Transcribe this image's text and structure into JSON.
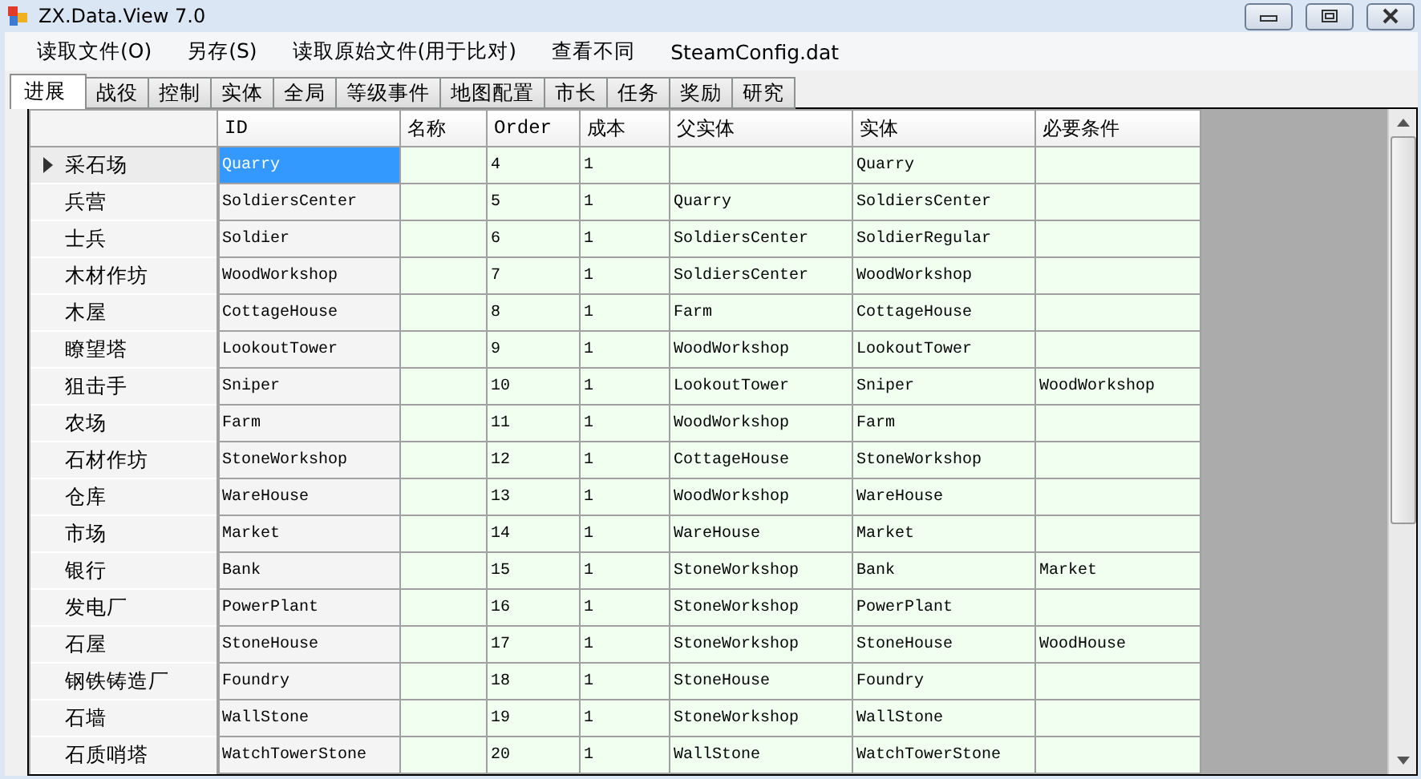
{
  "window": {
    "title": "ZX.Data.View 7.0"
  },
  "menu": [
    "读取文件(O)",
    "另存(S)",
    "读取原始文件(用于比对)",
    "查看不同",
    "SteamConfig.dat"
  ],
  "tabs": [
    {
      "label": "进展",
      "selected": true
    },
    {
      "label": "战役",
      "selected": false
    },
    {
      "label": "控制",
      "selected": false
    },
    {
      "label": "实体",
      "selected": false
    },
    {
      "label": "全局",
      "selected": false
    },
    {
      "label": "等级事件",
      "selected": false
    },
    {
      "label": "地图配置",
      "selected": false
    },
    {
      "label": "市长",
      "selected": false
    },
    {
      "label": "任务",
      "selected": false
    },
    {
      "label": "奖励",
      "selected": false
    },
    {
      "label": "研究",
      "selected": false
    }
  ],
  "table": {
    "columns": [
      "ID",
      "名称",
      "Order",
      "成本",
      "父实体",
      "实体",
      "必要条件"
    ],
    "rows": [
      {
        "header": "采石场",
        "current": true,
        "cells": [
          "Quarry",
          "",
          "4",
          "1",
          "",
          "Quarry",
          ""
        ]
      },
      {
        "header": "兵营",
        "current": false,
        "cells": [
          "SoldiersCenter",
          "",
          "5",
          "1",
          "Quarry",
          "SoldiersCenter",
          ""
        ]
      },
      {
        "header": "士兵",
        "current": false,
        "cells": [
          "Soldier",
          "",
          "6",
          "1",
          "SoldiersCenter",
          "SoldierRegular",
          ""
        ]
      },
      {
        "header": "木材作坊",
        "current": false,
        "cells": [
          "WoodWorkshop",
          "",
          "7",
          "1",
          "SoldiersCenter",
          "WoodWorkshop",
          ""
        ]
      },
      {
        "header": "木屋",
        "current": false,
        "cells": [
          "CottageHouse",
          "",
          "8",
          "1",
          "Farm",
          "CottageHouse",
          ""
        ]
      },
      {
        "header": "瞭望塔",
        "current": false,
        "cells": [
          "LookoutTower",
          "",
          "9",
          "1",
          "WoodWorkshop",
          "LookoutTower",
          ""
        ]
      },
      {
        "header": "狙击手",
        "current": false,
        "cells": [
          "Sniper",
          "",
          "10",
          "1",
          "LookoutTower",
          "Sniper",
          "WoodWorkshop"
        ]
      },
      {
        "header": "农场",
        "current": false,
        "cells": [
          "Farm",
          "",
          "11",
          "1",
          "WoodWorkshop",
          "Farm",
          ""
        ]
      },
      {
        "header": "石材作坊",
        "current": false,
        "cells": [
          "StoneWorkshop",
          "",
          "12",
          "1",
          "CottageHouse",
          "StoneWorkshop",
          ""
        ]
      },
      {
        "header": "仓库",
        "current": false,
        "cells": [
          "WareHouse",
          "",
          "13",
          "1",
          "WoodWorkshop",
          "WareHouse",
          ""
        ]
      },
      {
        "header": "市场",
        "current": false,
        "cells": [
          "Market",
          "",
          "14",
          "1",
          "WareHouse",
          "Market",
          ""
        ]
      },
      {
        "header": "银行",
        "current": false,
        "cells": [
          "Bank",
          "",
          "15",
          "1",
          "StoneWorkshop",
          "Bank",
          "Market"
        ]
      },
      {
        "header": "发电厂",
        "current": false,
        "cells": [
          "PowerPlant",
          "",
          "16",
          "1",
          "StoneWorkshop",
          "PowerPlant",
          ""
        ]
      },
      {
        "header": "石屋",
        "current": false,
        "cells": [
          "StoneHouse",
          "",
          "17",
          "1",
          "StoneWorkshop",
          "StoneHouse",
          "WoodHouse"
        ]
      },
      {
        "header": "钢铁铸造厂",
        "current": false,
        "cells": [
          "Foundry",
          "",
          "18",
          "1",
          "StoneHouse",
          "Foundry",
          ""
        ]
      },
      {
        "header": "石墙",
        "current": false,
        "cells": [
          "WallStone",
          "",
          "19",
          "1",
          "StoneWorkshop",
          "WallStone",
          ""
        ]
      },
      {
        "header": "石质哨塔",
        "current": false,
        "cells": [
          "WatchTowerStone",
          "",
          "20",
          "1",
          "WallStone",
          "WatchTowerStone",
          ""
        ]
      }
    ]
  }
}
